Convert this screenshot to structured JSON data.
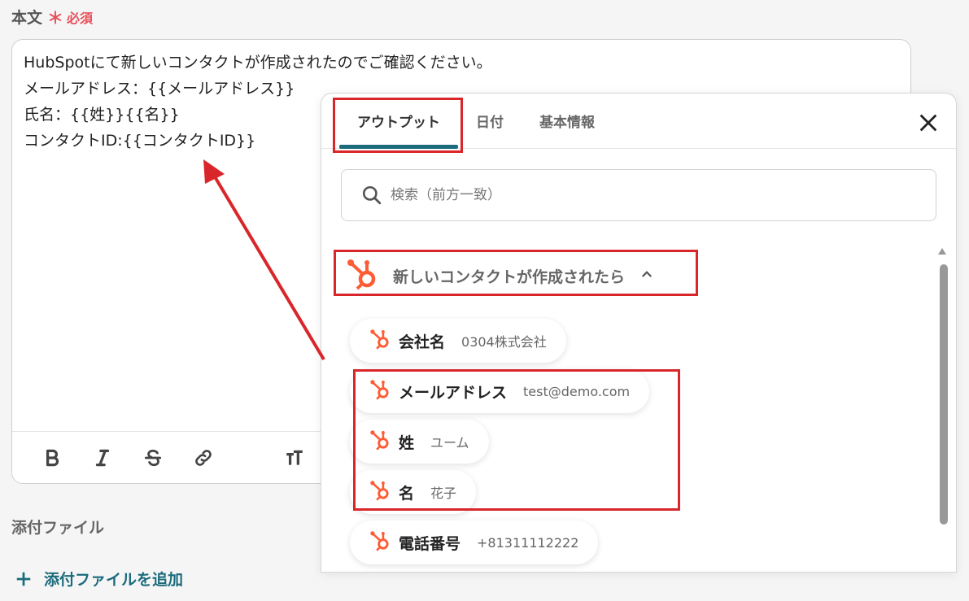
{
  "field": {
    "label": "本文",
    "asterisk": "＊",
    "required": "必須"
  },
  "editor": {
    "lines": [
      "HubSpotにて新しいコンタクトが作成されたのでご確認ください。",
      "メールアドレス：{{メールアドレス}}",
      "氏名：{{姓}}{{名}}",
      "コンタクトID:{{コンタクトID}}"
    ]
  },
  "toolbar": {
    "icons": [
      "bold-icon",
      "italic-icon",
      "strikethrough-icon",
      "link-icon",
      "text-size-icon",
      "list-icon"
    ]
  },
  "attachments": {
    "label": "添付ファイル",
    "add_label": "添付ファイルを追加"
  },
  "popup": {
    "tabs": [
      {
        "label": "アウトプット",
        "active": true
      },
      {
        "label": "日付",
        "active": false
      },
      {
        "label": "基本情報",
        "active": false
      }
    ],
    "search_placeholder": "検索（前方一致）",
    "section_title": "新しいコンタクトが作成されたら",
    "items": [
      {
        "key": "会社名",
        "value": "0304株式会社"
      },
      {
        "key": "メールアドレス",
        "value": "test@demo.com"
      },
      {
        "key": "姓",
        "value": "ユーム"
      },
      {
        "key": "名",
        "value": "花子"
      },
      {
        "key": "電話番号",
        "value": "+81311112222"
      }
    ]
  },
  "colors": {
    "accent": "#1b6b7d",
    "hubspot": "#ff5c35",
    "highlight": "#d9262a",
    "required": "#e8505b"
  }
}
